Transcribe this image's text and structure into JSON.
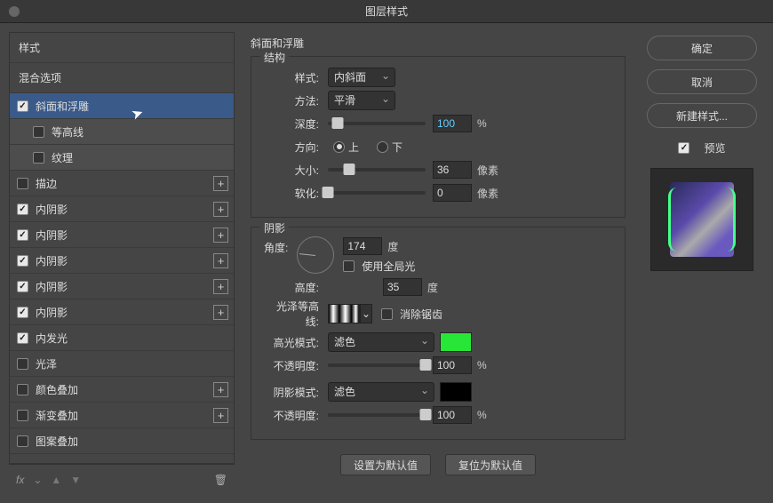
{
  "title": "图层样式",
  "sidebar": {
    "header1": "样式",
    "header2": "混合选项",
    "items": [
      {
        "label": "斜面和浮雕",
        "checked": true,
        "selected": true,
        "plus": false,
        "sub": false
      },
      {
        "label": "等高线",
        "checked": false,
        "selected": false,
        "plus": false,
        "sub": true
      },
      {
        "label": "纹理",
        "checked": false,
        "selected": false,
        "plus": false,
        "sub": true
      },
      {
        "label": "描边",
        "checked": false,
        "selected": false,
        "plus": true,
        "sub": false
      },
      {
        "label": "内阴影",
        "checked": true,
        "selected": false,
        "plus": true,
        "sub": false
      },
      {
        "label": "内阴影",
        "checked": true,
        "selected": false,
        "plus": true,
        "sub": false
      },
      {
        "label": "内阴影",
        "checked": true,
        "selected": false,
        "plus": true,
        "sub": false
      },
      {
        "label": "内阴影",
        "checked": true,
        "selected": false,
        "plus": true,
        "sub": false
      },
      {
        "label": "内阴影",
        "checked": true,
        "selected": false,
        "plus": true,
        "sub": false
      },
      {
        "label": "内发光",
        "checked": true,
        "selected": false,
        "plus": false,
        "sub": false
      },
      {
        "label": "光泽",
        "checked": false,
        "selected": false,
        "plus": false,
        "sub": false
      },
      {
        "label": "颜色叠加",
        "checked": false,
        "selected": false,
        "plus": true,
        "sub": false
      },
      {
        "label": "渐变叠加",
        "checked": false,
        "selected": false,
        "plus": true,
        "sub": false
      },
      {
        "label": "图案叠加",
        "checked": false,
        "selected": false,
        "plus": false,
        "sub": false
      }
    ],
    "footer_fx": "fx"
  },
  "main": {
    "title": "斜面和浮雕",
    "structure": {
      "legend": "结构",
      "style_label": "样式:",
      "style_value": "内斜面",
      "technique_label": "方法:",
      "technique_value": "平滑",
      "depth_label": "深度:",
      "depth_value": "100",
      "depth_unit": "%",
      "direction_label": "方向:",
      "direction_up": "上",
      "direction_down": "下",
      "size_label": "大小:",
      "size_value": "36",
      "size_unit": "像素",
      "soften_label": "软化:",
      "soften_value": "0",
      "soften_unit": "像素"
    },
    "shading": {
      "legend": "阴影",
      "angle_label": "角度:",
      "angle_value": "174",
      "angle_unit": "度",
      "global_label": "使用全局光",
      "altitude_label": "高度:",
      "altitude_value": "35",
      "altitude_unit": "度",
      "contour_label": "光泽等高线:",
      "anti_alias": "消除锯齿",
      "highlight_mode_label": "高光模式:",
      "highlight_mode_value": "滤色",
      "highlight_color": "#28e637",
      "highlight_opacity_label": "不透明度:",
      "highlight_opacity_value": "100",
      "highlight_opacity_unit": "%",
      "shadow_mode_label": "阴影模式:",
      "shadow_mode_value": "滤色",
      "shadow_color": "#000000",
      "shadow_opacity_label": "不透明度:",
      "shadow_opacity_value": "100",
      "shadow_opacity_unit": "%"
    },
    "defaults_btn": "设置为默认值",
    "reset_btn": "复位为默认值"
  },
  "right": {
    "ok": "确定",
    "cancel": "取消",
    "new_style": "新建样式...",
    "preview": "预览"
  }
}
